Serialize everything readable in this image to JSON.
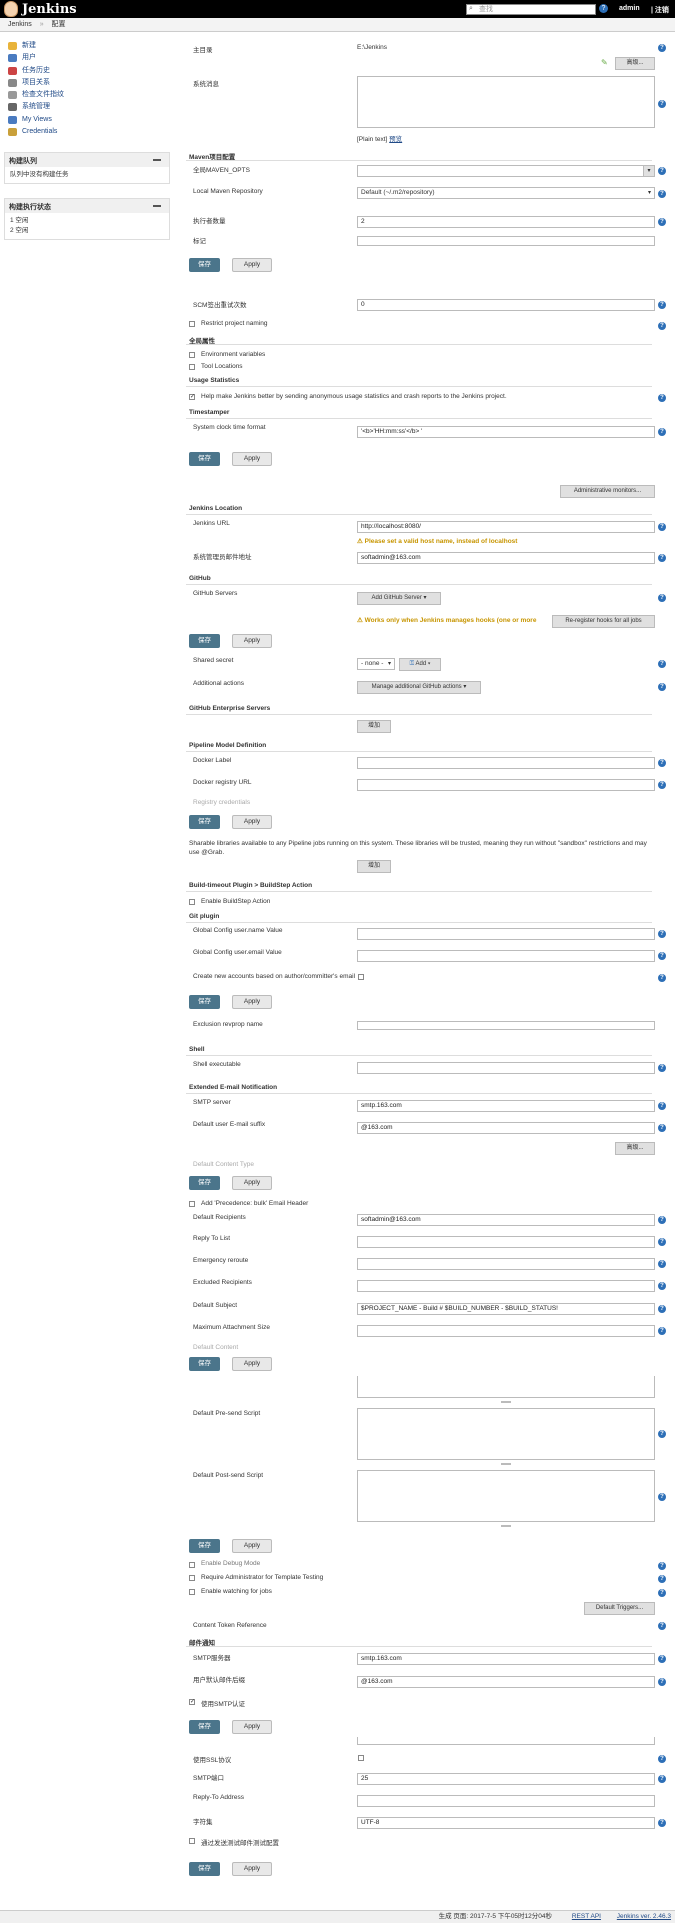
{
  "header": {
    "logo_text": "Jenkins",
    "search_placeholder": "查找",
    "user": "admin",
    "logout": "| 注销",
    "help_icon": "help-icon"
  },
  "breadcrumb": {
    "items": [
      "Jenkins",
      "»",
      "配置"
    ]
  },
  "sidebar": {
    "tasks": [
      {
        "label": "新建",
        "icon": "new-item-icon",
        "color": "#e8b33a"
      },
      {
        "label": "用户",
        "icon": "users-icon",
        "color": "#4a7bc0"
      },
      {
        "label": "任务历史",
        "icon": "history-icon",
        "color": "#c44"
      },
      {
        "label": "项目关系",
        "icon": "relationship-icon",
        "color": "#888"
      },
      {
        "label": "检查文件指纹",
        "icon": "fingerprint-icon",
        "color": "#999"
      },
      {
        "label": "系统管理",
        "icon": "gear-icon",
        "color": "#666"
      },
      {
        "label": "My Views",
        "icon": "views-icon",
        "color": "#4a7bc0"
      },
      {
        "label": "Credentials",
        "icon": "credentials-icon",
        "color": "#c9a03a"
      }
    ],
    "queue": {
      "title": "构建队列",
      "empty": "队列中没有构建任务"
    },
    "executors": {
      "title": "构建执行状态",
      "items": [
        "1  空闲",
        "2  空闲"
      ]
    }
  },
  "main": {
    "home_dir_label": "主目录",
    "home_dir_value": "E:\\Jenkins",
    "advanced": "高级...",
    "system_message_label": "系统消息",
    "plain_text": "[Plain text]",
    "preview": "预览",
    "maven_section": "Maven项目配置",
    "maven_opts_label": "全局MAVEN_OPTS",
    "local_repo_label": "Local Maven Repository",
    "local_repo_value": "Default (~/.m2/repository)",
    "executors_label": "执行者数量",
    "executors_value": "2",
    "labels_label": "标记",
    "save": "保存",
    "apply": "Apply",
    "scm_retry_label": "SCM签出重试次数",
    "scm_retry_value": "0",
    "restrict_naming": "Restrict project naming",
    "global_props": "全局属性",
    "env_vars": "Environment variables",
    "tool_locations": "Tool Locations",
    "usage_section": "Usage Statistics",
    "usage_text": "Help make Jenkins better by sending anonymous usage statistics and crash reports to the Jenkins project.",
    "timestamper_section": "Timestamper",
    "clock_format_label": "System clock time format",
    "clock_format_value": "'<b>'HH:mm:ss'</b> '",
    "admin_monitors": "Administrative monitors...",
    "location_section": "Jenkins Location",
    "jenkins_url_label": "Jenkins URL",
    "jenkins_url_value": "http://localhost:8080/",
    "url_warning": "Please set a valid host name, instead of localhost",
    "admin_email_label": "系统管理员邮件地址",
    "admin_email_value": "softadmin@163.com",
    "github_section": "GitHub",
    "github_servers_label": "GitHub Servers",
    "add_github_server": "Add GitHub Server",
    "github_warning": "Works only when Jenkins manages hooks (one or more",
    "re_register": "Re-register hooks for all jobs",
    "shared_secret_label": "Shared secret",
    "none_option": "- none -",
    "add_btn": "Add",
    "additional_actions_label": "Additional actions",
    "manage_github_actions": "Manage additional GitHub actions",
    "github_ent_section": "GitHub Enterprise Servers",
    "add": "增加",
    "pipeline_section": "Pipeline Model Definition",
    "docker_label": "Docker Label",
    "docker_registry_label": "Docker registry URL",
    "registry_credentials": "Registry credentials",
    "shared_libs_text": "Sharable libraries available to any Pipeline jobs running on this system. These libraries will be trusted, meaning they run without \"sandbox\" restrictions and may use @Grab.",
    "build_timeout_section": "Build-timeout Plugin > BuildStep Action",
    "enable_buildstep": "Enable BuildStep Action",
    "git_section": "Git plugin",
    "git_user_label": "Global Config user.name Value",
    "git_email_label": "Global Config user.email Value",
    "create_accounts_label": "Create new accounts based on author/committer's email",
    "exclusion_label": "Exclusion revprop name",
    "shell_section": "Shell",
    "shell_exec_label": "Shell executable",
    "email_ext_section": "Extended E-mail Notification",
    "smtp_server_label": "SMTP server",
    "smtp_server_value": "smtp.163.com",
    "default_suffix_label": "Default user E-mail suffix",
    "default_suffix_value": "@163.com",
    "default_content_type": "Default Content Type",
    "add_precedence": "Add 'Precedence: bulk' Email Header",
    "default_recipients_label": "Default Recipients",
    "default_recipients_value": "softadmin@163.com",
    "reply_to_label": "Reply To List",
    "emergency_label": "Emergency reroute",
    "excluded_label": "Excluded Recipients",
    "default_subject_label": "Default Subject",
    "default_subject_value": "$PROJECT_NAME - Build # $BUILD_NUMBER - $BUILD_STATUS!",
    "max_attach_label": "Maximum Attachment Size",
    "default_content_label": "Default Content",
    "presend_label": "Default Pre-send Script",
    "postsend_label": "Default Post-send Script",
    "enable_debug": "Enable Debug Mode",
    "require_admin": "Require Administrator for Template Testing",
    "enable_watching": "Enable watching for jobs",
    "default_triggers": "Default Triggers...",
    "content_token": "Content Token Reference",
    "mail_section": "邮件通知",
    "smtp_label": "SMTP服务器",
    "smtp_value": "smtp.163.com",
    "suffix_label": "用户默认邮件后缀",
    "suffix_value": "@163.com",
    "use_smtp_auth": "使用SMTP认证",
    "use_ssl": "使用SSL协议",
    "smtp_port_label": "SMTP端口",
    "smtp_port_value": "25",
    "reply_to_addr_label": "Reply-To Address",
    "charset_label": "字符集",
    "charset_value": "UTF-8",
    "test_email": "通过发送测试邮件测试配置"
  },
  "footer": {
    "generated": "生成 页面: 2017-7-5 下午05时12分04秒",
    "rest_api": "REST API",
    "version": "Jenkins ver. 2.46.3"
  }
}
